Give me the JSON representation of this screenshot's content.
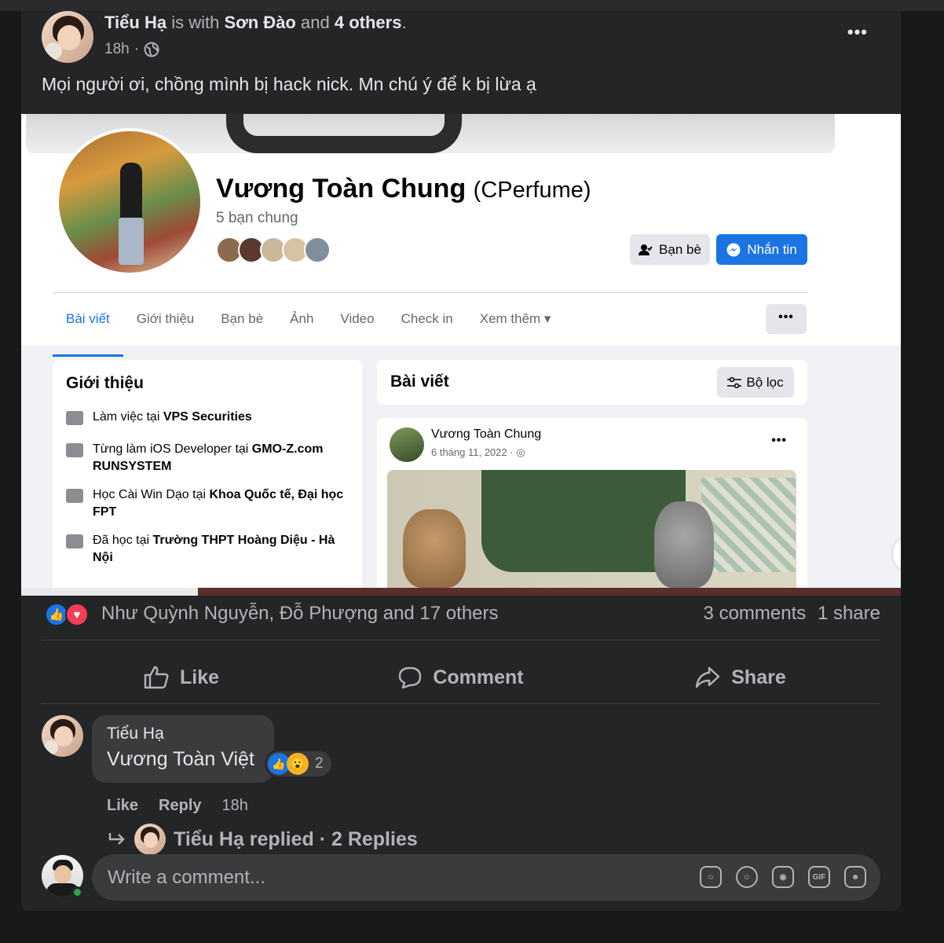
{
  "post": {
    "author": "Tiểu Hạ",
    "with_text": "is with",
    "tagged": "Sơn Đào",
    "and_text": "and",
    "others": "4 others",
    "period": ".",
    "time": "18h",
    "text": "Mọi người ơi, chồng mình bị hack nick. Mn chú ý để k bị lừa ạ",
    "more_icon": "more-horizontal-icon",
    "privacy_icon": "globe-icon"
  },
  "screenshot": {
    "profile_name": "Vương Toàn Chung",
    "profile_alias": "(CPerfume)",
    "mutual_friends": "5 bạn chung",
    "friend_button": "Bạn bè",
    "message_button": "Nhắn tin",
    "tabs": [
      "Bài viết",
      "Giới thiệu",
      "Bạn bè",
      "Ảnh",
      "Video",
      "Check in",
      "Xem thêm ▾"
    ],
    "intro": {
      "title": "Giới thiệu",
      "items": [
        {
          "prefix": "Làm việc tại ",
          "bold": "VPS Securities"
        },
        {
          "prefix": "Từng làm iOS Developer tại ",
          "bold": "GMO-Z.com RUNSYSTEM"
        },
        {
          "prefix": "Học Cài Win Dạo tại ",
          "bold": "Khoa Quốc tế, Đại học FPT"
        },
        {
          "prefix": "Đã học tại ",
          "bold": "Trường THPT Hoàng Diệu - Hà Nội"
        }
      ]
    },
    "posts_title": "Bài viết",
    "filter_button": "Bộ lọc",
    "inner_post": {
      "author": "Vương Toàn Chung",
      "date": "6 tháng 11, 2022 ·"
    }
  },
  "reactions": {
    "names": "Như Quỳnh Nguyễn, Đỗ Phượng and 17 others",
    "comments": "3 comments",
    "shares": "1 share"
  },
  "actions": {
    "like": "Like",
    "comment": "Comment",
    "share": "Share"
  },
  "comment": {
    "author": "Tiểu Hạ",
    "text": "Vương Toàn Việt",
    "reaction_count": "2",
    "like": "Like",
    "reply": "Reply",
    "time": "18h",
    "replies_text": "Tiểu Hạ replied · 2 Replies"
  },
  "composer": {
    "placeholder": "Write a comment..."
  },
  "colors": {
    "accent": "#1b74e4",
    "love": "#f33e58",
    "online": "#31a24c"
  }
}
